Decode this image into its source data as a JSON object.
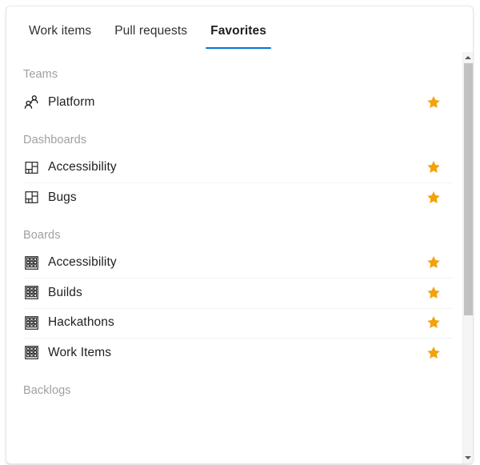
{
  "tabs": [
    {
      "label": "Work items",
      "selected": false
    },
    {
      "label": "Pull requests",
      "selected": false
    },
    {
      "label": "Favorites",
      "selected": true
    }
  ],
  "colors": {
    "accent": "#0078d4",
    "star": "#f2a20c",
    "group_header_text": "#a19f9d",
    "row_text": "#201f1e",
    "separator": "#f3f2f1",
    "scrollbar_thumb": "#c1c1c1",
    "scrollbar_track": "#f5f5f5"
  },
  "groups": [
    {
      "title": "Teams",
      "icon": "people-icon",
      "items": [
        {
          "label": "Platform",
          "favorited": true,
          "star_icon": "star-filled-icon"
        }
      ]
    },
    {
      "title": "Dashboards",
      "icon": "dashboard-tiles-icon",
      "items": [
        {
          "label": "Accessibility",
          "favorited": true,
          "star_icon": "star-filled-icon"
        },
        {
          "label": "Bugs",
          "favorited": true,
          "star_icon": "star-filled-icon"
        }
      ]
    },
    {
      "title": "Boards",
      "icon": "kanban-board-icon",
      "items": [
        {
          "label": "Accessibility",
          "favorited": true,
          "star_icon": "star-filled-icon"
        },
        {
          "label": "Builds",
          "favorited": true,
          "star_icon": "star-filled-icon"
        },
        {
          "label": "Hackathons",
          "favorited": true,
          "star_icon": "star-filled-icon"
        },
        {
          "label": "Work Items",
          "favorited": true,
          "star_icon": "star-filled-icon"
        }
      ]
    },
    {
      "title": "Backlogs",
      "icon": "backlog-icon",
      "items": []
    }
  ],
  "scrollbar": {
    "up_arrow_icon": "scroll-up-arrow-icon",
    "down_arrow_icon": "scroll-down-arrow-icon",
    "thumb_name": "scrollbar-thumb"
  }
}
